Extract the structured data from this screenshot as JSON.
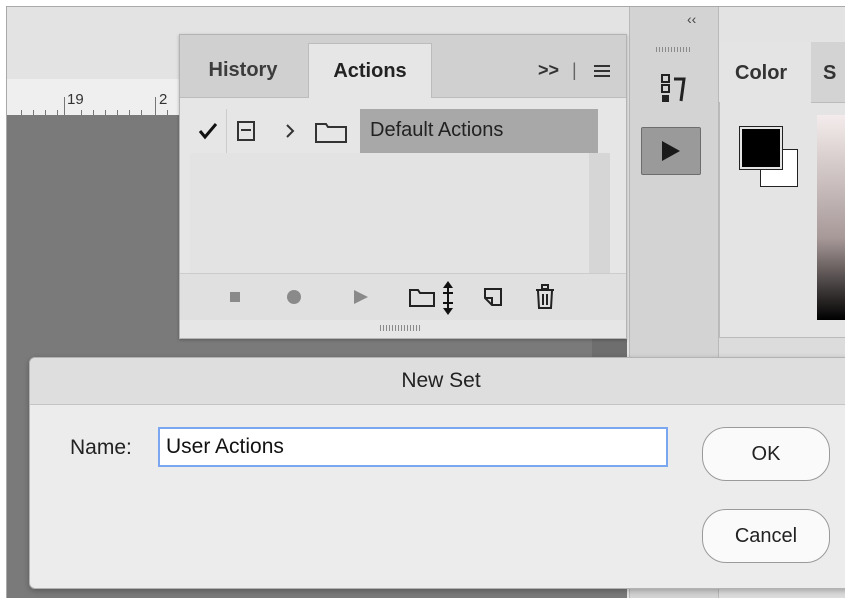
{
  "ruler": {
    "labels": [
      "19",
      "2"
    ]
  },
  "actions_panel": {
    "tabs": [
      {
        "label": "History"
      },
      {
        "label": "Actions"
      }
    ],
    "overflow_label": ">>",
    "rows": [
      {
        "label": "Default Actions"
      }
    ],
    "toolbar_icons": [
      "stop-icon",
      "record-icon",
      "play-icon",
      "new-set-icon",
      "new-action-icon",
      "delete-icon"
    ]
  },
  "color_panel": {
    "tabs": [
      {
        "label": "Color"
      },
      {
        "label": "S"
      }
    ],
    "foreground": "#000000",
    "background": "#ffffff"
  },
  "dialog": {
    "title": "New Set",
    "name_label": "Name:",
    "name_value": "User Actions",
    "ok_label": "OK",
    "cancel_label": "Cancel"
  },
  "colors": {
    "accent_focus": "#7aa7f0",
    "canvas": "#7a7a7a",
    "highlight_row": "#a8a8a8"
  }
}
